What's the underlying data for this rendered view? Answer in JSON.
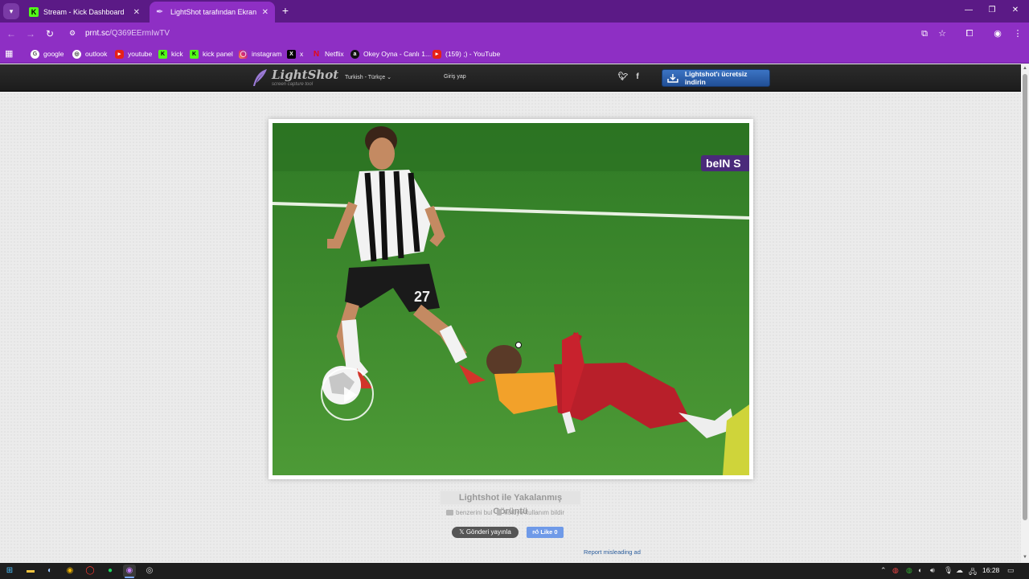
{
  "browser": {
    "tabs": [
      {
        "label": "Stream - Kick Dashboard",
        "active": false
      },
      {
        "label": "LightShot tarafından Ekran Görü",
        "active": true
      }
    ],
    "url_host": "prnt.sc",
    "url_path": "/Q369EErmIwTV",
    "bookmarks": [
      {
        "label": "google",
        "icon": "google-icon"
      },
      {
        "label": "outlook",
        "icon": "outlook-icon"
      },
      {
        "label": "youtube",
        "icon": "youtube-icon"
      },
      {
        "label": "kick",
        "icon": "kick-icon"
      },
      {
        "label": "kick panel",
        "icon": "kick-icon"
      },
      {
        "label": "instagram",
        "icon": "instagram-icon"
      },
      {
        "label": "x",
        "icon": "x-icon"
      },
      {
        "label": "Netflix",
        "icon": "netflix-icon"
      },
      {
        "label": "Okey Oyna - Canlı 1...",
        "icon": "okey-icon"
      },
      {
        "label": "(159) ;) - YouTube",
        "icon": "youtube-icon"
      }
    ]
  },
  "lightshot": {
    "logo_title": "LightShot",
    "logo_subtitle": "screen capture tool",
    "language": "Turkish - Türkçe",
    "login": "Giriş yap",
    "download_button": "Lightshot'ı ücretsiz indirin",
    "caption_title": "Lightshot ile Yakalanmış Görüntü",
    "find_similar": "benzerini bul",
    "report_abuse": "kötüye kullanım bildir",
    "share_x": "Gönderi yayınla",
    "share_fb": "Like 0",
    "report_ad": "Report misleading ad",
    "image": {
      "channel_logo": "beIN S",
      "player_number": "27"
    }
  },
  "taskbar": {
    "clock": "16:28"
  },
  "colors": {
    "tabbar": "#5b1a86",
    "toolbar": "#8e2fc4",
    "header": "#222222",
    "download_button": "#2d61ad",
    "pitch": "#3f8a2e"
  }
}
